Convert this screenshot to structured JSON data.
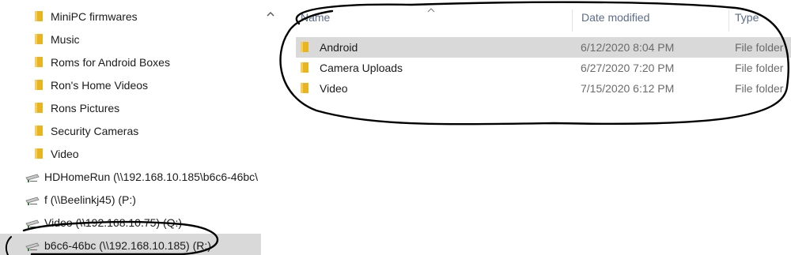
{
  "nav": {
    "items": [
      {
        "kind": "folder",
        "label": "MiniPC firmwares"
      },
      {
        "kind": "folder",
        "label": "Music"
      },
      {
        "kind": "folder",
        "label": "Roms for Android Boxes"
      },
      {
        "kind": "folder",
        "label": "Ron's Home Videos"
      },
      {
        "kind": "folder",
        "label": "Rons Pictures"
      },
      {
        "kind": "folder",
        "label": "Security Cameras"
      },
      {
        "kind": "folder",
        "label": "Video"
      },
      {
        "kind": "drive",
        "label": "HDHomeRun (\\\\192.168.10.185\\b6c6-46bc\\"
      },
      {
        "kind": "drive",
        "label": "f (\\\\Beelinkj45) (P:)"
      },
      {
        "kind": "drive",
        "label": "Video (\\\\192.168.10.75) (Q:)"
      },
      {
        "kind": "drive",
        "label": "b6c6-46bc (\\\\192.168.10.185) (R:)",
        "selected": true
      }
    ],
    "scroll_up_glyph": "^"
  },
  "columns": {
    "name": "Name",
    "date_modified": "Date modified",
    "type": "Type",
    "sort_glyph": "^"
  },
  "files": [
    {
      "name": "Android",
      "date": "6/12/2020 8:04 PM",
      "type": "File folder",
      "selected": true
    },
    {
      "name": "Camera Uploads",
      "date": "6/27/2020 7:20 PM",
      "type": "File folder"
    },
    {
      "name": "Video",
      "date": "7/15/2020 6:12 PM",
      "type": "File folder"
    }
  ],
  "colors": {
    "folder_yellow": "#e8b422",
    "selection_gray": "#d9d9d9",
    "header_text": "#5c6c8a",
    "annotation_ink": "#000000"
  }
}
